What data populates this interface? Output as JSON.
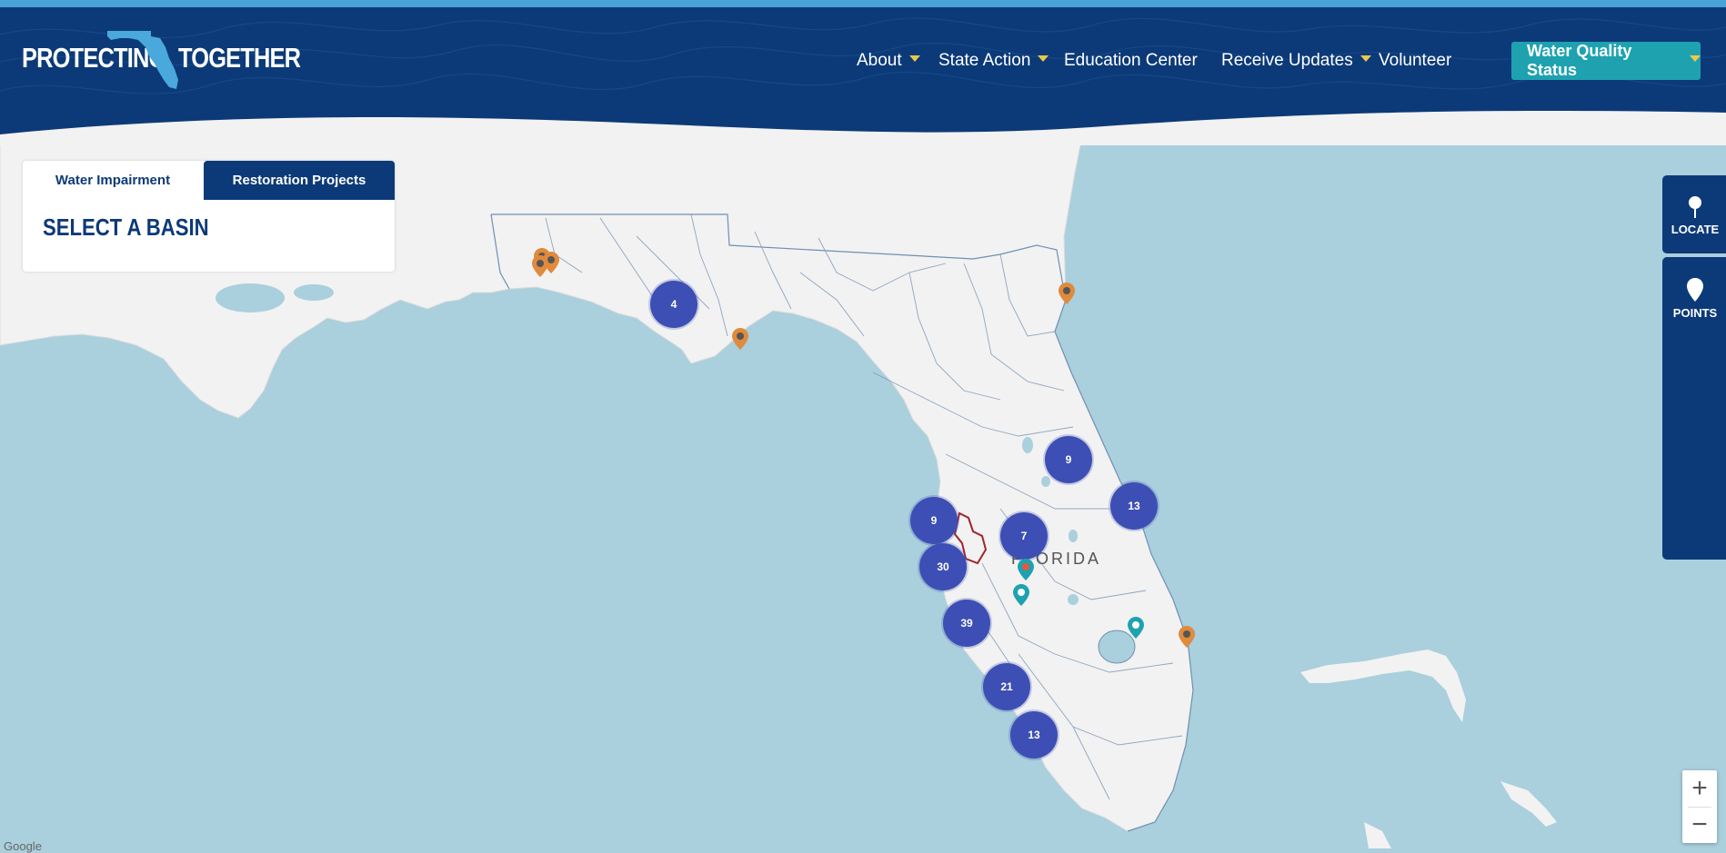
{
  "header": {
    "logo_left": "PROTECTING",
    "logo_right": "TOGETHER",
    "nav": [
      {
        "label": "About",
        "has_dropdown": true
      },
      {
        "label": "State Action",
        "has_dropdown": true
      },
      {
        "label": "Education Center",
        "has_dropdown": false
      },
      {
        "label": "Receive Updates",
        "has_dropdown": true
      },
      {
        "label": "Volunteer",
        "has_dropdown": false
      }
    ],
    "status_button": "Water Quality Status"
  },
  "panel": {
    "tabs": [
      "Water Impairment",
      "Restoration Projects"
    ],
    "active_tab": "Water Impairment",
    "title": "SELECT A BASIN"
  },
  "side_controls": {
    "locate": "LOCATE",
    "points": "POINTS"
  },
  "map": {
    "state_label": "FLORIDA",
    "attribution": "Google",
    "clusters": [
      "4",
      "9",
      "13",
      "9",
      "7",
      "30",
      "39",
      "21",
      "13"
    ]
  },
  "zoom": {
    "in": "+",
    "out": "−"
  },
  "colors": {
    "navy": "#0c3a78",
    "teal": "#1ea2b0",
    "cluster": "#3d4fb4",
    "water": "#aacfdd",
    "land": "#f2f2f2",
    "pin_orange": "#e08a3c",
    "pin_teal": "#1ea2b0"
  }
}
